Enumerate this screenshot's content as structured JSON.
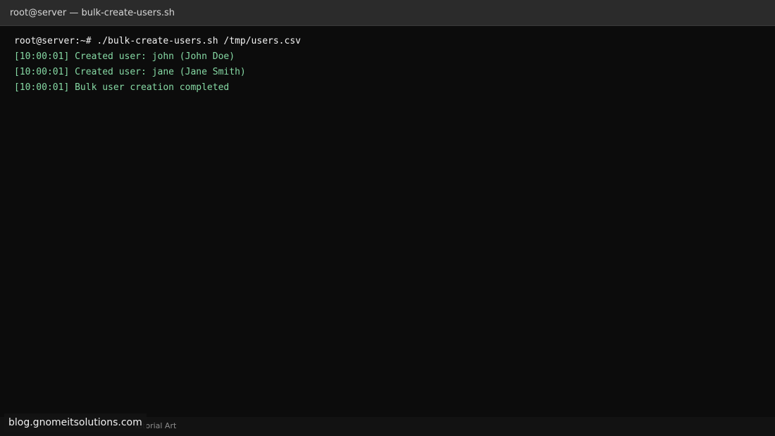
{
  "window": {
    "title": "root@server — bulk-create-users.sh"
  },
  "terminal": {
    "lines": [
      {
        "text": "root@server:~# ./bulk-create-users.sh /tmp/users.csv",
        "kind": "command"
      },
      {
        "text": "[10:00:01] Created user: john (John Doe)",
        "kind": "log"
      },
      {
        "text": "[10:00:01] Created user: jane (Jane Smith)",
        "kind": "log"
      },
      {
        "text": "[10:00:01] Bulk user creation completed",
        "kind": "log"
      }
    ]
  },
  "footer": {
    "caption": "Tutorial Art",
    "watermark": "blog.gnomeitsolutions.com"
  },
  "colors": {
    "background": "#0c0c0c",
    "titlebar": "#2b2b2b",
    "command_text": "#f2f2f2",
    "log_text": "#86d9a4"
  }
}
